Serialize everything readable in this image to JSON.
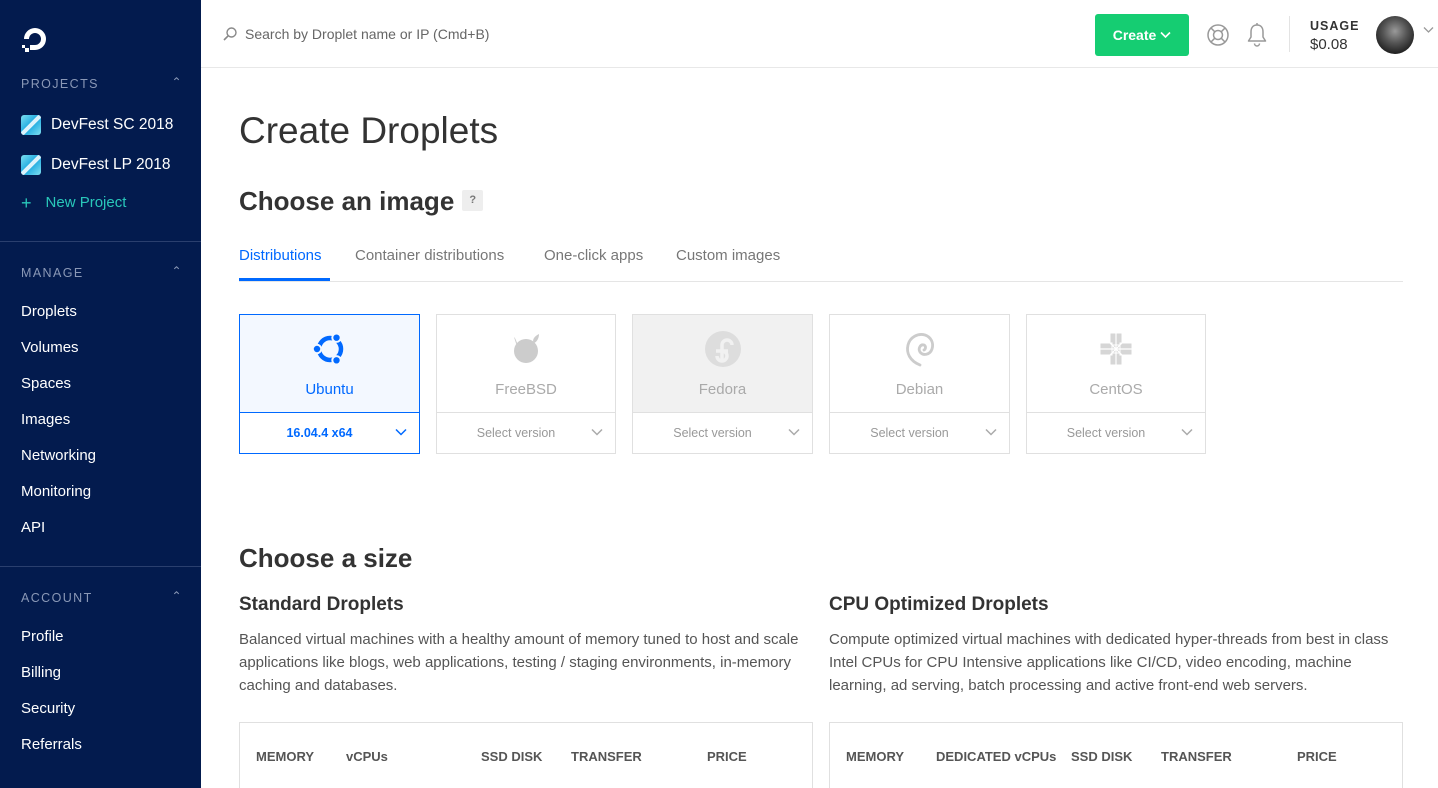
{
  "sidebar": {
    "projects_header": "PROJECTS",
    "projects": [
      {
        "label": "DevFest SC 2018"
      },
      {
        "label": "DevFest LP 2018"
      }
    ],
    "new_project": "New Project",
    "manage_header": "MANAGE",
    "manage_items": [
      {
        "label": "Droplets"
      },
      {
        "label": "Volumes"
      },
      {
        "label": "Spaces"
      },
      {
        "label": "Images"
      },
      {
        "label": "Networking"
      },
      {
        "label": "Monitoring"
      },
      {
        "label": "API"
      }
    ],
    "account_header": "ACCOUNT",
    "account_items": [
      {
        "label": "Profile"
      },
      {
        "label": "Billing"
      },
      {
        "label": "Security"
      },
      {
        "label": "Referrals"
      }
    ]
  },
  "topbar": {
    "search_placeholder": "Search by Droplet name or IP (Cmd+B)",
    "create_label": "Create",
    "usage_label": "USAGE",
    "usage_value": "$0.08"
  },
  "main": {
    "page_title": "Create Droplets",
    "choose_image_title": "Choose an image",
    "help_badge": "?",
    "tabs": [
      {
        "label": "Distributions",
        "active": true
      },
      {
        "label": "Container distributions"
      },
      {
        "label": "One-click apps"
      },
      {
        "label": "Custom images"
      }
    ],
    "distributions": [
      {
        "name": "Ubuntu",
        "version": "16.04.4 x64",
        "icon": "ubuntu-icon",
        "state": "selected"
      },
      {
        "name": "FreeBSD",
        "version": "Select version",
        "icon": "freebsd-icon",
        "state": "normal"
      },
      {
        "name": "Fedora",
        "version": "Select version",
        "icon": "fedora-icon",
        "state": "disabled"
      },
      {
        "name": "Debian",
        "version": "Select version",
        "icon": "debian-icon",
        "state": "normal"
      },
      {
        "name": "CentOS",
        "version": "Select version",
        "icon": "centos-icon",
        "state": "normal"
      }
    ],
    "choose_size_title": "Choose a size",
    "standard": {
      "title": "Standard Droplets",
      "description": "Balanced virtual machines with a healthy amount of memory tuned to host and scale applications like blogs, web applications, testing / staging environments, in-memory caching and databases.",
      "columns": [
        "MEMORY",
        "vCPUs",
        "SSD DISK",
        "TRANSFER",
        "PRICE"
      ]
    },
    "cpu_optimized": {
      "title": "CPU Optimized Droplets",
      "description": "Compute optimized virtual machines with dedicated hyper-threads from best in class Intel CPUs for CPU Intensive applications like CI/CD, video encoding, machine learning, ad serving, batch processing and active front-end web servers.",
      "columns": [
        "MEMORY",
        "DEDICATED vCPUs",
        "SSD DISK",
        "TRANSFER",
        "PRICE"
      ]
    }
  },
  "colors": {
    "sidebar_bg": "#031b4e",
    "accent_blue": "#0069ff",
    "create_green": "#15cd72",
    "new_project_teal": "#29c8ba"
  }
}
